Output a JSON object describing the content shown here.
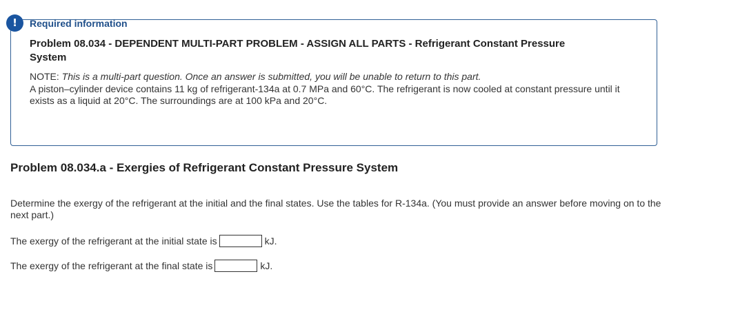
{
  "alert_icon": "exclamation-icon",
  "colors": {
    "accent": "#1a55a0",
    "box_border": "#2f5f95",
    "heading_blue": "#1f4f8a"
  },
  "info": {
    "heading": "Required information",
    "problem_title": "Problem 08.034 - DEPENDENT MULTI-PART PROBLEM - ASSIGN ALL PARTS - Refrigerant Constant Pressure System",
    "note_label": "NOTE: ",
    "note_text": "This is a multi-part question. Once an answer is submitted, you will be unable to return to this part.",
    "description": "A piston–cylinder device contains 11 kg of refrigerant-134a at 0.7 MPa and 60°C. The refrigerant is now cooled at constant pressure until it exists as a liquid at 20°C. The surroundings are at 100 kPa and 20°C."
  },
  "part": {
    "title": "Problem 08.034.a - Exergies of Refrigerant Constant Pressure System",
    "instructions": "Determine the exergy of the refrigerant at the initial and the final states. Use the tables for R-134a. (You must provide an answer before moving on to the next part.)",
    "q1_prompt": "The exergy of the refrigerant at the initial state is",
    "q1_value": "",
    "q1_unit": "kJ.",
    "q2_prompt": "The exergy of the refrigerant at the final state is",
    "q2_value": "",
    "q2_unit": "kJ."
  }
}
